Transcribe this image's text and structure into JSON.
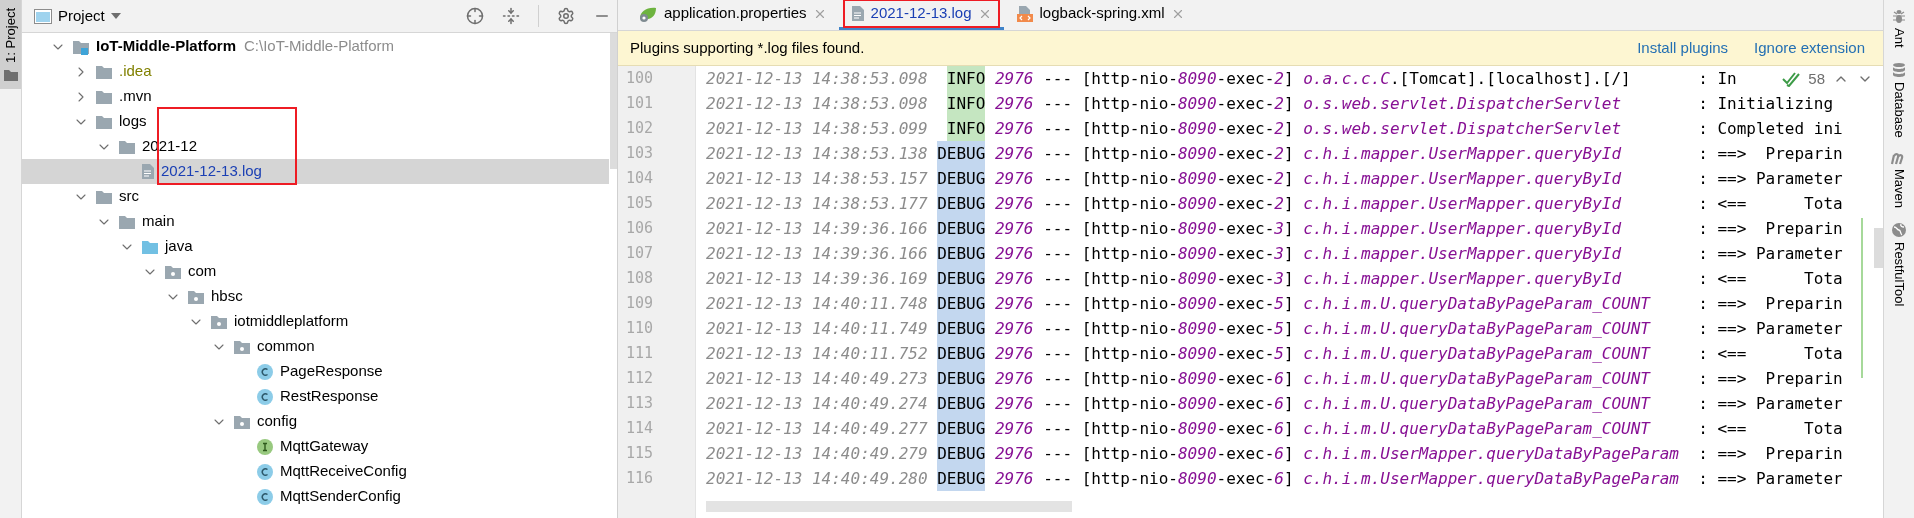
{
  "left_stripe": {
    "label": "1: Project",
    "selected": true
  },
  "project_panel": {
    "title": "Project",
    "tree": [
      {
        "name": "IoT-Middle-Platform",
        "path": "C:\\IoT-Middle-Platform",
        "kind": "module",
        "expanded": true,
        "selected": false,
        "ignored": false,
        "modified": false,
        "highlighted": false,
        "children": [
          {
            "name": ".idea",
            "kind": "folder",
            "expanded": false,
            "selected": false,
            "ignored": true,
            "modified": false,
            "highlighted": false
          },
          {
            "name": ".mvn",
            "kind": "folder",
            "expanded": false,
            "selected": false,
            "ignored": false,
            "modified": false,
            "highlighted": false
          },
          {
            "name": "logs",
            "kind": "folder",
            "expanded": true,
            "selected": false,
            "ignored": false,
            "modified": false,
            "highlighted": false,
            "children": [
              {
                "name": "2021-12",
                "kind": "folder",
                "expanded": true,
                "selected": false,
                "ignored": false,
                "modified": false,
                "highlighted": false,
                "children": [
                  {
                    "name": "2021-12-13.log",
                    "kind": "log_file",
                    "selected": true,
                    "ignored": false,
                    "modified": true,
                    "highlighted": true
                  }
                ]
              }
            ]
          },
          {
            "name": "src",
            "kind": "folder",
            "expanded": true,
            "selected": false,
            "ignored": false,
            "modified": false,
            "highlighted": false,
            "children": [
              {
                "name": "main",
                "kind": "folder",
                "expanded": true,
                "selected": false,
                "ignored": false,
                "modified": false,
                "highlighted": false,
                "children": [
                  {
                    "name": "java",
                    "kind": "source_folder",
                    "expanded": true,
                    "selected": false,
                    "ignored": false,
                    "modified": false,
                    "highlighted": false,
                    "children": [
                      {
                        "name": "com",
                        "kind": "package",
                        "expanded": true,
                        "selected": false,
                        "ignored": false,
                        "modified": false,
                        "highlighted": false,
                        "children": [
                          {
                            "name": "hbsc",
                            "kind": "package",
                            "expanded": true,
                            "selected": false,
                            "ignored": false,
                            "modified": false,
                            "highlighted": false,
                            "children": [
                              {
                                "name": "iotmiddleplatform",
                                "kind": "package",
                                "expanded": true,
                                "selected": false,
                                "ignored": false,
                                "modified": false,
                                "highlighted": false,
                                "children": [
                                  {
                                    "name": "common",
                                    "kind": "package",
                                    "expanded": true,
                                    "selected": false,
                                    "ignored": false,
                                    "modified": false,
                                    "highlighted": false,
                                    "children": [
                                      {
                                        "name": "PageResponse",
                                        "kind": "class",
                                        "selected": false,
                                        "ignored": false,
                                        "modified": false,
                                        "highlighted": false
                                      },
                                      {
                                        "name": "RestResponse",
                                        "kind": "class",
                                        "selected": false,
                                        "ignored": false,
                                        "modified": false,
                                        "highlighted": false
                                      }
                                    ]
                                  },
                                  {
                                    "name": "config",
                                    "kind": "package",
                                    "expanded": true,
                                    "selected": false,
                                    "ignored": false,
                                    "modified": false,
                                    "highlighted": false,
                                    "children": [
                                      {
                                        "name": "MqttGateway",
                                        "kind": "interface",
                                        "selected": false,
                                        "ignored": false,
                                        "modified": false,
                                        "highlighted": false
                                      },
                                      {
                                        "name": "MqttReceiveConfig",
                                        "kind": "class",
                                        "selected": false,
                                        "ignored": false,
                                        "modified": false,
                                        "highlighted": false
                                      },
                                      {
                                        "name": "MqttSenderConfig",
                                        "kind": "class",
                                        "selected": false,
                                        "ignored": false,
                                        "modified": false,
                                        "highlighted": false
                                      }
                                    ]
                                  }
                                ]
                              }
                            ]
                          }
                        ]
                      }
                    ]
                  }
                ]
              }
            ]
          }
        ]
      }
    ]
  },
  "tabs": [
    {
      "label": "application.properties",
      "kind": "properties",
      "selected": false,
      "highlighted": false
    },
    {
      "label": "2021-12-13.log",
      "kind": "log",
      "selected": true,
      "highlighted": true
    },
    {
      "label": "logback-spring.xml",
      "kind": "xml",
      "selected": false,
      "highlighted": false
    }
  ],
  "banner": {
    "text": "Plugins supporting *.log files found.",
    "links": [
      "Install plugins",
      "Ignore extension"
    ]
  },
  "inspection": {
    "count": "58"
  },
  "log_lines": [
    {
      "number": "100",
      "time": "2021-12-13 14:38:53.098",
      "level": "INFO",
      "pid": "2976",
      "sep": "---",
      "thread": "[http-nio-*8090*-exec-*2*]",
      "logger": "o.a.c.c.C",
      "logger_tail": ".[Tomcat].[localhost].[/]",
      "message": ": In"
    },
    {
      "number": "101",
      "time": "2021-12-13 14:38:53.098",
      "level": "INFO",
      "pid": "2976",
      "sep": "---",
      "thread": "[http-nio-*8090*-exec-*2*]",
      "logger": "o.s.web.servlet.DispatcherServlet",
      "message": ": Initializing"
    },
    {
      "number": "102",
      "time": "2021-12-13 14:38:53.099",
      "level": "INFO",
      "pid": "2976",
      "sep": "---",
      "thread": "[http-nio-*8090*-exec-*2*]",
      "logger": "o.s.web.servlet.DispatcherServlet",
      "message": ": Completed ini"
    },
    {
      "number": "103",
      "time": "2021-12-13 14:38:53.138",
      "level": "DEBUG",
      "pid": "2976",
      "sep": "---",
      "thread": "[http-nio-*8090*-exec-*2*]",
      "logger": "c.h.i.mapper.UserMapper.queryById",
      "message": ": ==>  Preparin"
    },
    {
      "number": "104",
      "time": "2021-12-13 14:38:53.157",
      "level": "DEBUG",
      "pid": "2976",
      "sep": "---",
      "thread": "[http-nio-*8090*-exec-*2*]",
      "logger": "c.h.i.mapper.UserMapper.queryById",
      "message": ": ==> Parameter"
    },
    {
      "number": "105",
      "time": "2021-12-13 14:38:53.177",
      "level": "DEBUG",
      "pid": "2976",
      "sep": "---",
      "thread": "[http-nio-*8090*-exec-*2*]",
      "logger": "c.h.i.mapper.UserMapper.queryById",
      "message": ": <==      Tota"
    },
    {
      "number": "106",
      "time": "2021-12-13 14:39:36.166",
      "level": "DEBUG",
      "pid": "2976",
      "sep": "---",
      "thread": "[http-nio-*8090*-exec-*3*]",
      "logger": "c.h.i.mapper.UserMapper.queryById",
      "message": ": ==>  Preparin"
    },
    {
      "number": "107",
      "time": "2021-12-13 14:39:36.166",
      "level": "DEBUG",
      "pid": "2976",
      "sep": "---",
      "thread": "[http-nio-*8090*-exec-*3*]",
      "logger": "c.h.i.mapper.UserMapper.queryById",
      "message": ": ==> Parameter"
    },
    {
      "number": "108",
      "time": "2021-12-13 14:39:36.169",
      "level": "DEBUG",
      "pid": "2976",
      "sep": "---",
      "thread": "[http-nio-*8090*-exec-*3*]",
      "logger": "c.h.i.mapper.UserMapper.queryById",
      "message": ": <==      Tota"
    },
    {
      "number": "109",
      "time": "2021-12-13 14:40:11.748",
      "level": "DEBUG",
      "pid": "2976",
      "sep": "---",
      "thread": "[http-nio-*8090*-exec-*5*]",
      "logger": "c.h.i.m.U.queryDataByPageParam_COUNT",
      "message": ": ==>  Preparin"
    },
    {
      "number": "110",
      "time": "2021-12-13 14:40:11.749",
      "level": "DEBUG",
      "pid": "2976",
      "sep": "---",
      "thread": "[http-nio-*8090*-exec-*5*]",
      "logger": "c.h.i.m.U.queryDataByPageParam_COUNT",
      "message": ": ==> Parameter"
    },
    {
      "number": "111",
      "time": "2021-12-13 14:40:11.752",
      "level": "DEBUG",
      "pid": "2976",
      "sep": "---",
      "thread": "[http-nio-*8090*-exec-*5*]",
      "logger": "c.h.i.m.U.queryDataByPageParam_COUNT",
      "message": ": <==      Tota"
    },
    {
      "number": "112",
      "time": "2021-12-13 14:40:49.273",
      "level": "DEBUG",
      "pid": "2976",
      "sep": "---",
      "thread": "[http-nio-*8090*-exec-*6*]",
      "logger": "c.h.i.m.U.queryDataByPageParam_COUNT",
      "message": ": ==>  Preparin"
    },
    {
      "number": "113",
      "time": "2021-12-13 14:40:49.274",
      "level": "DEBUG",
      "pid": "2976",
      "sep": "---",
      "thread": "[http-nio-*8090*-exec-*6*]",
      "logger": "c.h.i.m.U.queryDataByPageParam_COUNT",
      "message": ": ==> Parameter"
    },
    {
      "number": "114",
      "time": "2021-12-13 14:40:49.277",
      "level": "DEBUG",
      "pid": "2976",
      "sep": "---",
      "thread": "[http-nio-*8090*-exec-*6*]",
      "logger": "c.h.i.m.U.queryDataByPageParam_COUNT",
      "message": ": <==      Tota"
    },
    {
      "number": "115",
      "time": "2021-12-13 14:40:49.279",
      "level": "DEBUG",
      "pid": "2976",
      "sep": "---",
      "thread": "[http-nio-*8090*-exec-*6*]",
      "logger": "c.h.i.m.UserMapper.queryDataByPageParam",
      "message": ": ==>  Preparin"
    },
    {
      "number": "116",
      "time": "2021-12-13 14:40:49.280",
      "level": "DEBUG",
      "pid": "2976",
      "sep": "---",
      "thread": "[http-nio-*8090*-exec-*6*]",
      "logger": "c.h.i.m.UserMapper.queryDataByPageParam",
      "message": ": ==> Parameter"
    }
  ],
  "right_stripe": [
    {
      "label": "Ant",
      "kind": "ant"
    },
    {
      "label": "Database",
      "kind": "database"
    },
    {
      "label": "Maven",
      "kind": "maven"
    },
    {
      "label": "RestfulTool",
      "kind": "globe"
    }
  ]
}
